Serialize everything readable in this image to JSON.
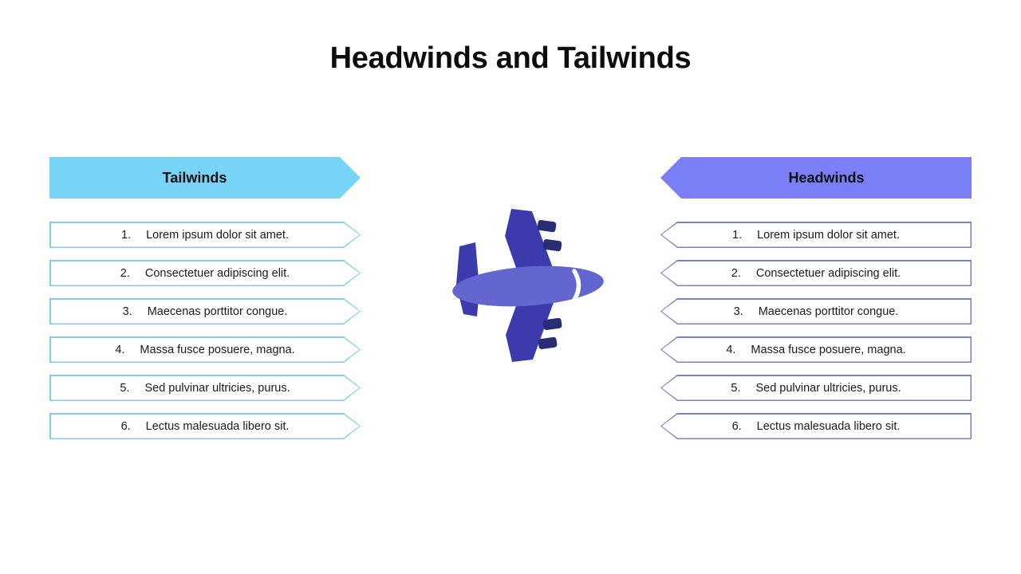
{
  "slide": {
    "title": "Headwinds and Tailwinds",
    "background_color": "#ffffff"
  },
  "left_panel": {
    "header_label": "Tailwinds",
    "accent_color": "#77D4F7",
    "border_color": "#7BCFEF",
    "direction": "right",
    "items": [
      {
        "number": "1.",
        "text": "Lorem ipsum dolor sit amet."
      },
      {
        "number": "2.",
        "text": "Consectetuer adipiscing elit."
      },
      {
        "number": "3.",
        "text": "Maecenas porttitor congue."
      },
      {
        "number": "4.",
        "text": "Massa fusce posuere, magna."
      },
      {
        "number": "5.",
        "text": "Sed pulvinar ultricies, purus."
      },
      {
        "number": "6.",
        "text": "Lectus malesuada libero sit."
      }
    ]
  },
  "right_panel": {
    "header_label": "Headwinds",
    "accent_color": "#7B7FF5",
    "border_color": "#7B7FD4",
    "direction": "left",
    "items": [
      {
        "number": "1.",
        "text": "Lorem ipsum dolor sit amet."
      },
      {
        "number": "2.",
        "text": "Consectetuer adipiscing elit."
      },
      {
        "number": "3.",
        "text": "Maecenas porttitor congue."
      },
      {
        "number": "4.",
        "text": "Massa fusce posuere, magna."
      },
      {
        "number": "5.",
        "text": "Sed pulvinar ultricies, purus."
      },
      {
        "number": "6.",
        "text": "Lectus malesuada libero sit."
      }
    ]
  },
  "center_graphic": {
    "icon_name": "airplane-icon",
    "wing_color": "#3B3BAE",
    "fuselage_color": "#6366CF",
    "engine_color": "#2A2D73",
    "cockpit_color": "#ffffff"
  }
}
